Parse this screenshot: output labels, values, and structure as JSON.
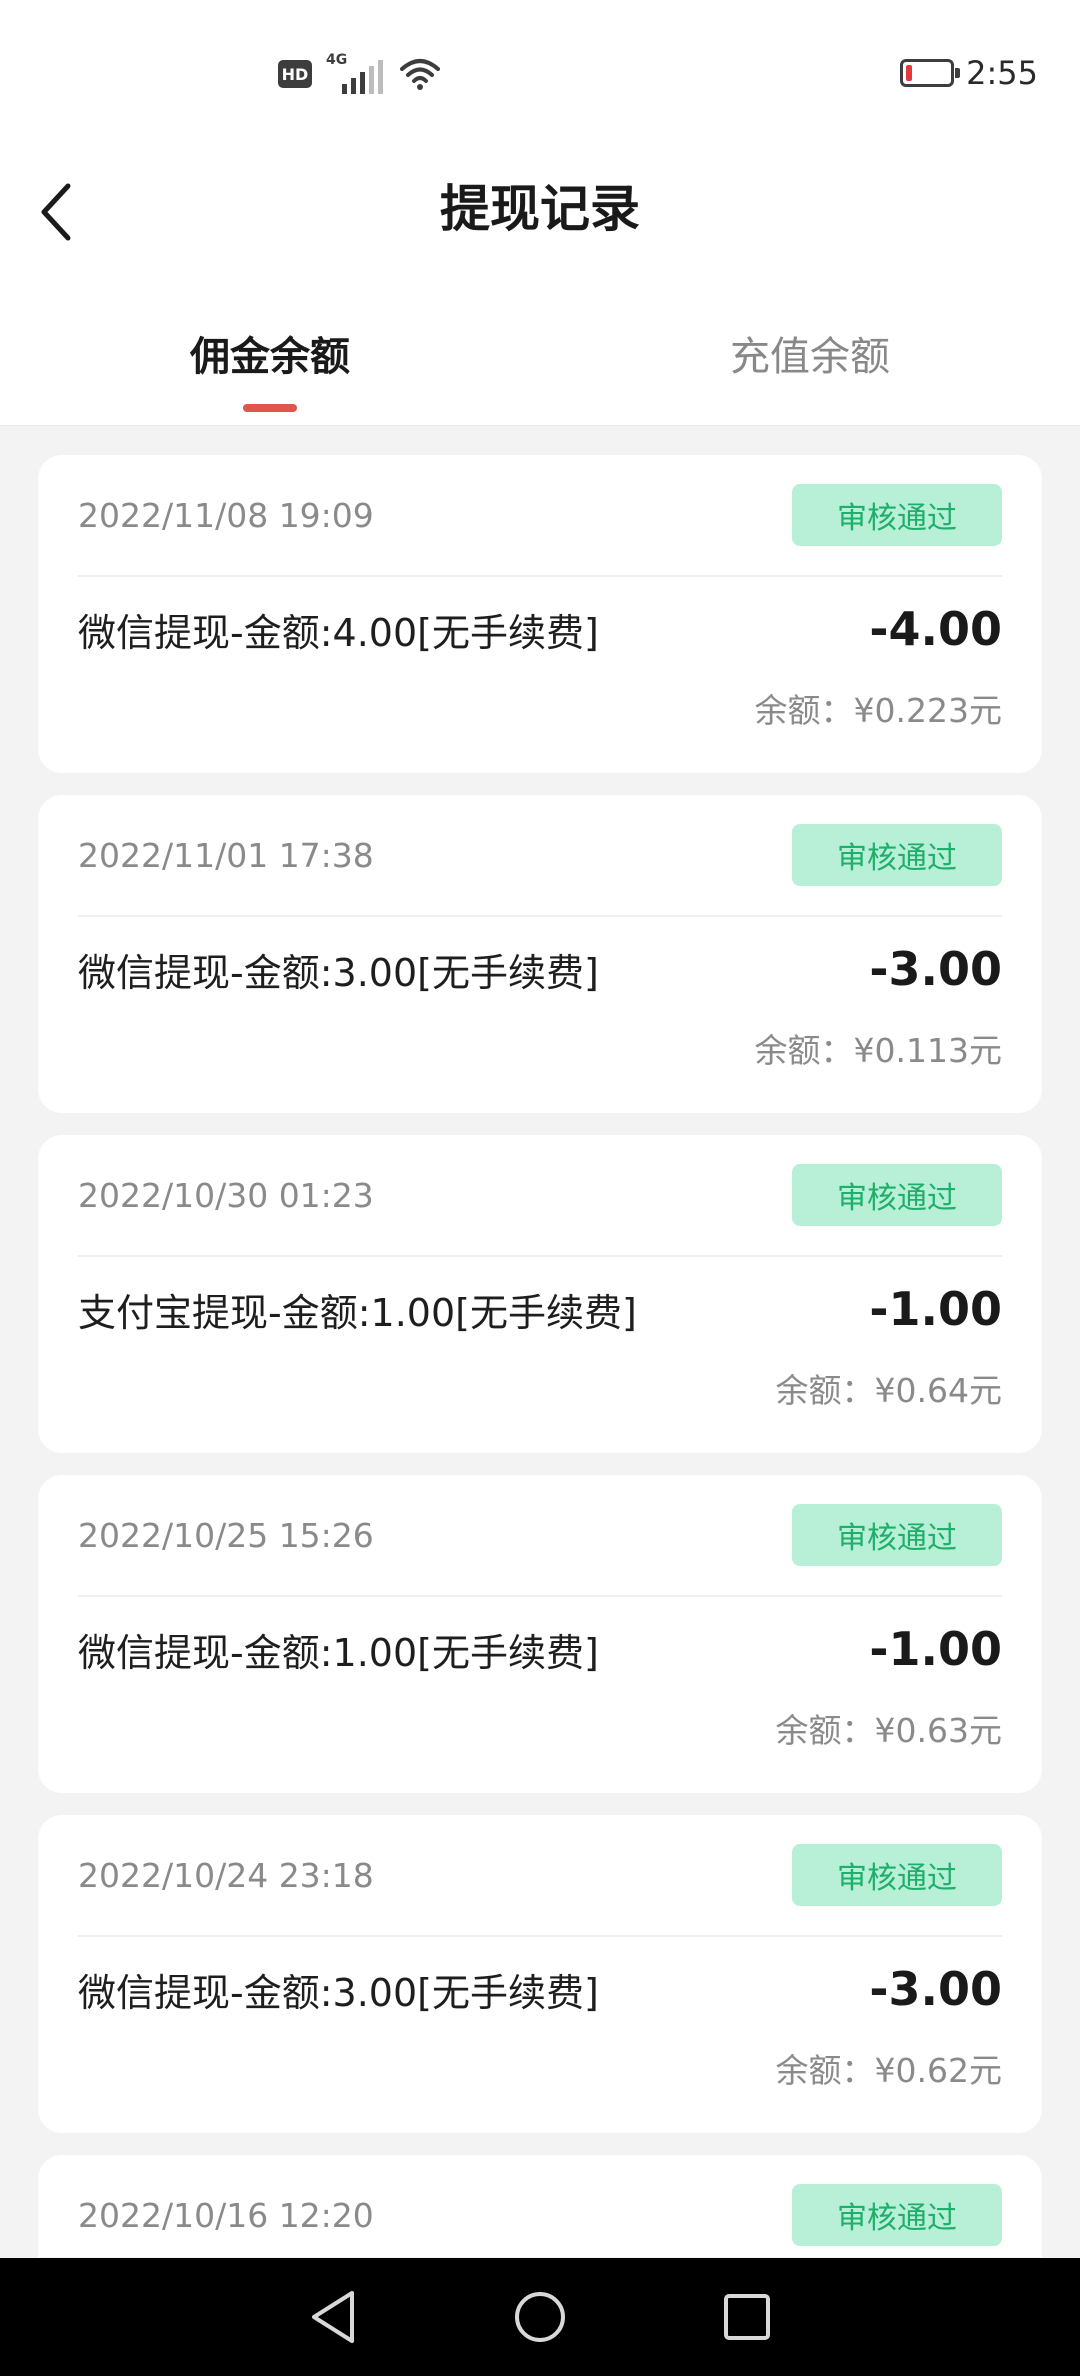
{
  "status_bar": {
    "hd_label": "HD",
    "network_label": "4G",
    "time": "2:55"
  },
  "header": {
    "title": "提现记录"
  },
  "tabs": [
    {
      "label": "佣金余额",
      "active": true
    },
    {
      "label": "充值余额",
      "active": false
    }
  ],
  "colors": {
    "accent": "#e0554e",
    "badge_bg": "#b7f0d6",
    "badge_text": "#1fae6b"
  },
  "records": [
    {
      "date": "2022/11/08 19:09",
      "status": "审核通过",
      "desc": "微信提现-金额:4.00[无手续费]",
      "amount": "-4.00",
      "balance": "余额：¥0.223元"
    },
    {
      "date": "2022/11/01 17:38",
      "status": "审核通过",
      "desc": "微信提现-金额:3.00[无手续费]",
      "amount": "-3.00",
      "balance": "余额：¥0.113元"
    },
    {
      "date": "2022/10/30 01:23",
      "status": "审核通过",
      "desc": "支付宝提现-金额:1.00[无手续费]",
      "amount": "-1.00",
      "balance": "余额：¥0.64元"
    },
    {
      "date": "2022/10/25 15:26",
      "status": "审核通过",
      "desc": "微信提现-金额:1.00[无手续费]",
      "amount": "-1.00",
      "balance": "余额：¥0.63元"
    },
    {
      "date": "2022/10/24 23:18",
      "status": "审核通过",
      "desc": "微信提现-金额:3.00[无手续费]",
      "amount": "-3.00",
      "balance": "余额：¥0.62元"
    },
    {
      "date": "2022/10/16 12:20",
      "status": "审核通过"
    }
  ],
  "icons": {
    "back": "chevron-left-icon",
    "nav_back": "triangle-back-icon",
    "nav_home": "circle-home-icon",
    "nav_recents": "square-recents-icon"
  }
}
